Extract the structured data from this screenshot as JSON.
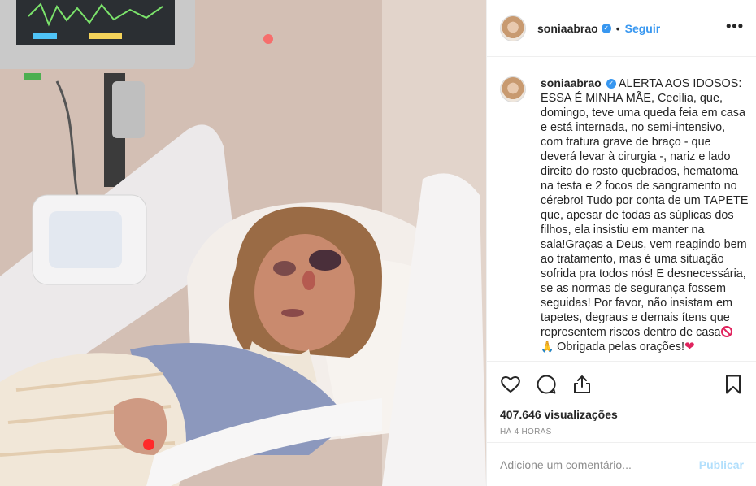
{
  "post": {
    "username": "soniaabrao",
    "verified_badge": "✓",
    "separator": "•",
    "follow_label": "Seguir",
    "more_label": "•••",
    "caption_part1": " ALERTA AOS IDOSOS: ESSA É MINHA MÃE, Cecília, que, domingo, teve uma queda feia em casa e está internada, no semi-intensivo, com fratura grave de braço - que deverá levar à cirurgia -, nariz e lado direito do rosto quebrados, hematoma na testa e 2 focos de sangramento no cérebro! Tudo por conta de um TAPETE que, apesar de todas as súplicas dos filhos, ela insistiu em manter na sala!Graças a Deus, vem reagindo bem ao tratamento, mas é uma situação sofrida pra todos nós! E desnecessária, se as normas de segurança fossem seguidas! Por favor, não insistam em tapetes, degraus e demais ítens que representem riscos dentro de casa",
    "emoji_hands": "🙏",
    "caption_part2": " Obrigada pelas orações!",
    "emoji_heart": "❤",
    "views": "407.646 visualizações",
    "time_ago": "HÁ 4 HORAS",
    "comment_placeholder": "Adicione um comentário...",
    "publish_label": "Publicar"
  },
  "icons": {
    "like": "heart-icon",
    "comment": "comment-icon",
    "share": "share-icon",
    "save": "bookmark-icon",
    "no_entry": "no-entry-emoji"
  },
  "colors": {
    "accent": "#3897f0",
    "publish_disabled": "#b2dffc",
    "muted": "#8e8e8e",
    "border": "#efefef"
  }
}
